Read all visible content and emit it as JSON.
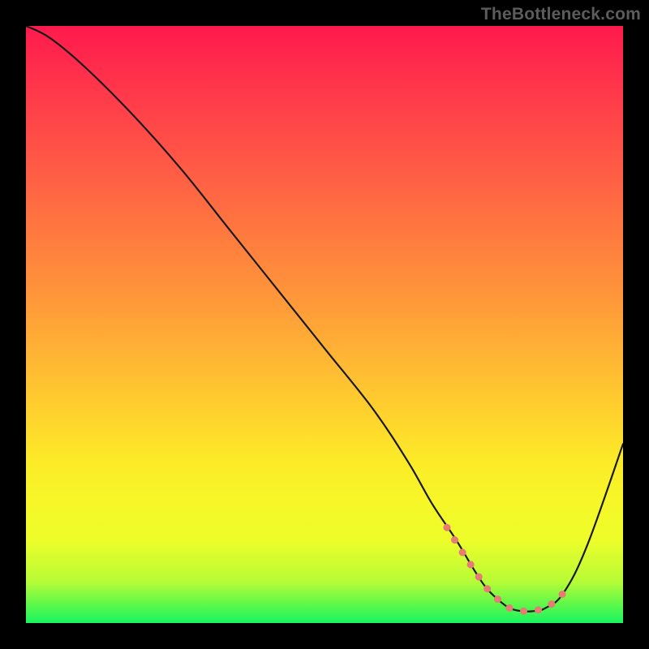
{
  "watermark": "TheBottleneck.com",
  "colors": {
    "curve": "#1a1a1a",
    "dots": "#e57d74",
    "frame": "#000000"
  },
  "chart_data": {
    "type": "line",
    "title": "",
    "xlabel": "",
    "ylabel": "",
    "xlim": [
      0,
      100
    ],
    "ylim": [
      0,
      100
    ],
    "series": [
      {
        "name": "bottleneck-curve",
        "x": [
          0,
          4,
          10,
          18,
          26,
          34,
          42,
          50,
          58,
          64,
          68,
          72,
          75,
          77,
          79,
          81,
          83,
          85,
          87,
          90,
          94,
          100
        ],
        "values": [
          100,
          98,
          93,
          85,
          76,
          66,
          56,
          46,
          36,
          27,
          20,
          14,
          9,
          6,
          4,
          2.5,
          2,
          2,
          2.5,
          5,
          13,
          30
        ]
      }
    ],
    "highlight_dots": {
      "name": "optimal-range",
      "x": [
        70.5,
        73,
        75,
        77,
        79,
        81,
        83,
        85,
        87,
        88.5,
        90
      ],
      "values": [
        16,
        12,
        9,
        6,
        4,
        2.5,
        2,
        2,
        2.5,
        3.5,
        5
      ]
    }
  }
}
